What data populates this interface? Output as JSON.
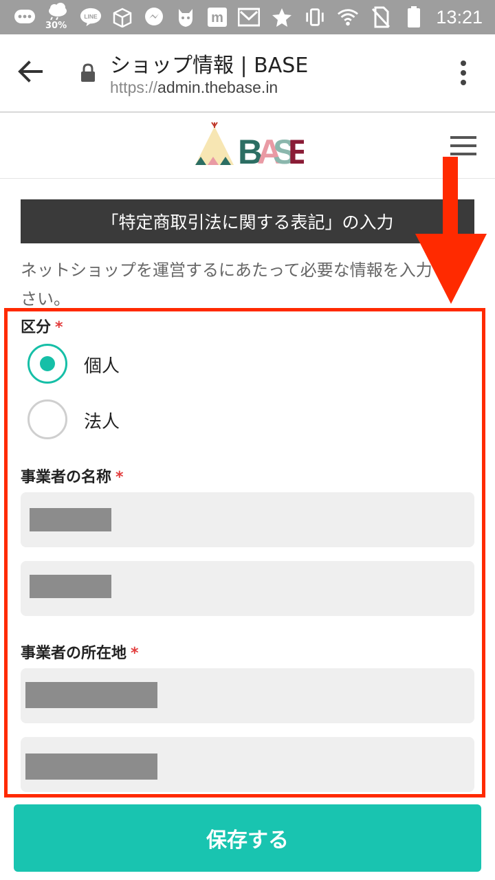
{
  "status_bar": {
    "battery_saver_pct": "30%",
    "time": "13:21",
    "icons": [
      "chat-bubble-icon",
      "weather-icon",
      "line-icon",
      "package-icon",
      "messenger-icon",
      "cat-app-icon",
      "m-app-icon",
      "mail-icon",
      "star-icon",
      "vibrate-icon",
      "wifi-icon",
      "no-sim-icon",
      "battery-icon"
    ],
    "line_label": "LINE"
  },
  "browser": {
    "title": "ショップ情報 | BASE",
    "url_scheme": "https://",
    "url_host": "admin.thebase.in"
  },
  "site": {
    "logo_text": "BASE"
  },
  "section": {
    "heading": "「特定商取引法に関する表記」の入力",
    "intro": "ネットショップを運営するにあたって必要な情報を入力ください。"
  },
  "form": {
    "classification": {
      "label": "区分",
      "required_mark": "*",
      "options": [
        {
          "label": "個人",
          "checked": true
        },
        {
          "label": "法人",
          "checked": false
        }
      ]
    },
    "business_name": {
      "label": "事業者の名称",
      "required_mark": "*"
    },
    "business_address": {
      "label": "事業者の所在地",
      "required_mark": "*"
    }
  },
  "save_button": "保存する",
  "colors": {
    "accent": "#19c4b0",
    "annotation": "#ff2a00",
    "banner": "#3a3a3a"
  }
}
